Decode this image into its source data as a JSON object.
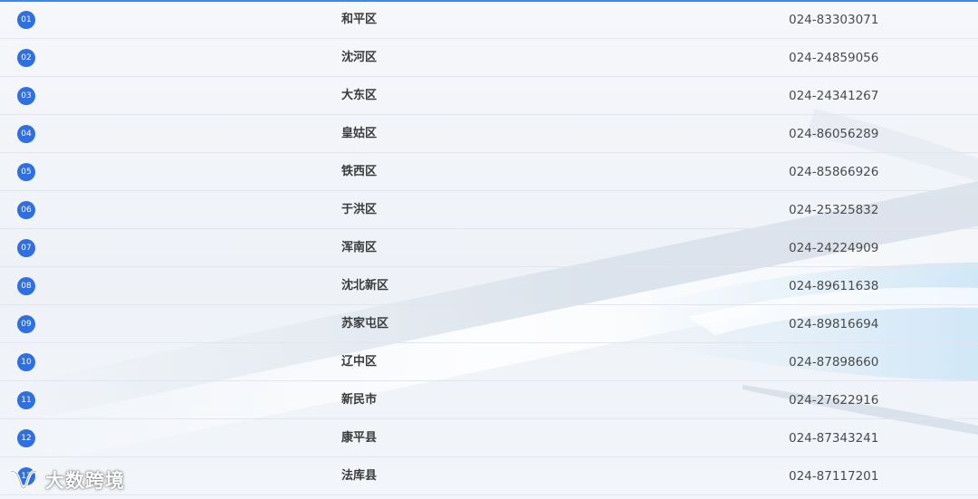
{
  "colors": {
    "accent": "#3f86e6",
    "badge": "#2f6fe0",
    "divider": "#e2e6ec"
  },
  "rows": [
    {
      "num": "01",
      "district": "和平区",
      "phone": "024-83303071"
    },
    {
      "num": "02",
      "district": "沈河区",
      "phone": "024-24859056"
    },
    {
      "num": "03",
      "district": "大东区",
      "phone": "024-24341267"
    },
    {
      "num": "04",
      "district": "皇姑区",
      "phone": "024-86056289"
    },
    {
      "num": "05",
      "district": "铁西区",
      "phone": "024-85866926"
    },
    {
      "num": "06",
      "district": "于洪区",
      "phone": "024-25325832"
    },
    {
      "num": "07",
      "district": "浑南区",
      "phone": "024-24224909"
    },
    {
      "num": "08",
      "district": "沈北新区",
      "phone": "024-89611638"
    },
    {
      "num": "09",
      "district": "苏家屯区",
      "phone": "024-89816694"
    },
    {
      "num": "10",
      "district": "辽中区",
      "phone": "024-87898660"
    },
    {
      "num": "11",
      "district": "新民市",
      "phone": "024-27622916"
    },
    {
      "num": "12",
      "district": "康平县",
      "phone": "024-87343241"
    },
    {
      "num": "13",
      "district": "法库县",
      "phone": "024-87117201"
    }
  ],
  "watermark": {
    "text": "大数跨境",
    "icon": "wechat-channel-icon"
  }
}
